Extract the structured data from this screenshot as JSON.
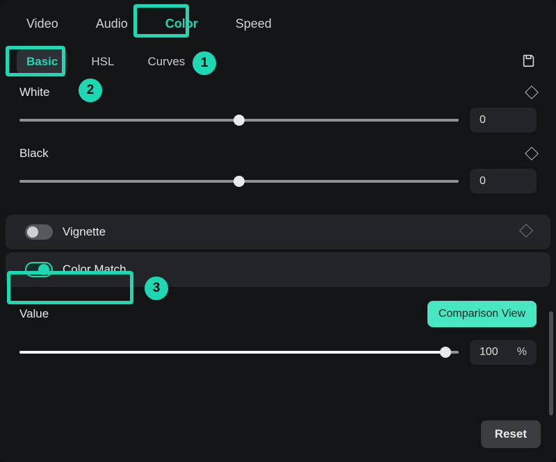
{
  "topTabs": {
    "video": "Video",
    "audio": "Audio",
    "color": "Color",
    "speed": "Speed"
  },
  "subTabs": {
    "basic": "Basic",
    "hsl": "HSL",
    "curves": "Curves"
  },
  "sliders": {
    "white": {
      "label": "White",
      "value": "0"
    },
    "black": {
      "label": "Black",
      "value": "0"
    }
  },
  "toggles": {
    "vignette": "Vignette",
    "colorMatch": "Color Match"
  },
  "valueSection": {
    "label": "Value",
    "comparison": "Comparison View",
    "value": "100",
    "unit": "%"
  },
  "footer": {
    "reset": "Reset"
  },
  "annotations": {
    "one": "1",
    "two": "2",
    "three": "3"
  }
}
